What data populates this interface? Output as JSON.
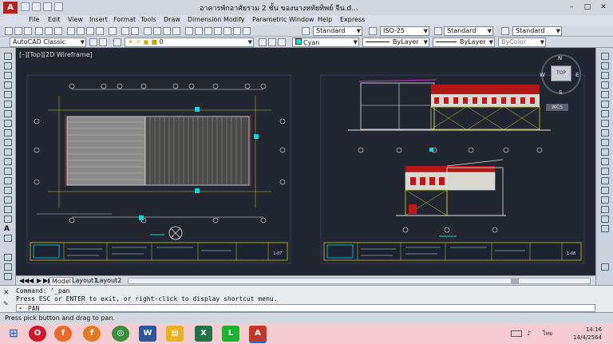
{
  "window": {
    "title": "อาคารพักอาศัยรวม 2 ชั้น ของนางหทัยทิพย์ จีน.d...",
    "controls": [
      "–",
      "□",
      "✕"
    ]
  },
  "menu": [
    "File",
    "Edit",
    "View",
    "Insert",
    "Format",
    "Tools",
    "Draw",
    "Dimension",
    "Modify",
    "Parametric",
    "Window",
    "Help",
    "Express"
  ],
  "toolbar": {
    "workspace": "AutoCAD Classic",
    "layer_value": "0",
    "text_style": "Standard",
    "dim_style": "ISO-25",
    "table_style": "Standard",
    "multileader_style": "Standard",
    "color": "Cyan",
    "linetype": "ByLayer",
    "lineweight": "ByLayer",
    "plotstyle": "ByColor"
  },
  "viewport": {
    "label": "[–][Top][2D Wireframe]"
  },
  "viewcube": {
    "n": "N",
    "s": "S",
    "e": "E",
    "w": "W",
    "face": "TOP",
    "wcs": "WCS"
  },
  "drawing": {
    "sheet_left_numbers": [
      "1-07"
    ],
    "sheet_right_numbers": [
      "1-08"
    ]
  },
  "layout_tabs": {
    "nav": [
      "◀◀",
      "◀",
      "▶",
      "▶▶"
    ],
    "tabs": [
      "Model",
      "Layout1",
      "Layout2"
    ]
  },
  "command": {
    "line1": "Command: '_pan",
    "line2": "Press ESC or ENTER to exit, or right-click to display shortcut menu.",
    "prompt": "PAN"
  },
  "status": {
    "text": "Press pick button and drag to pan."
  },
  "taskbar": {
    "apps": [
      {
        "name": "start",
        "glyph": "⊞",
        "color": "#1a6fd0"
      },
      {
        "name": "opera",
        "glyph": "O",
        "color": "#d0162a"
      },
      {
        "name": "firefox",
        "glyph": "f",
        "color": "#e8692a"
      },
      {
        "name": "firefox-2",
        "glyph": "f",
        "color": "#e27a24"
      },
      {
        "name": "chrome",
        "glyph": "◎",
        "color": "#3b8f3e"
      },
      {
        "name": "word",
        "glyph": "W",
        "color": "#2b579a"
      },
      {
        "name": "explorer",
        "glyph": "▤",
        "color": "#e6b324"
      },
      {
        "name": "excel",
        "glyph": "X",
        "color": "#217346"
      },
      {
        "name": "line",
        "glyph": "L",
        "color": "#19b32f"
      },
      {
        "name": "autocad",
        "glyph": "A",
        "color": "#c0392b"
      }
    ],
    "lang": "ไทย",
    "time": "14:16",
    "date": "14/4/2564"
  }
}
